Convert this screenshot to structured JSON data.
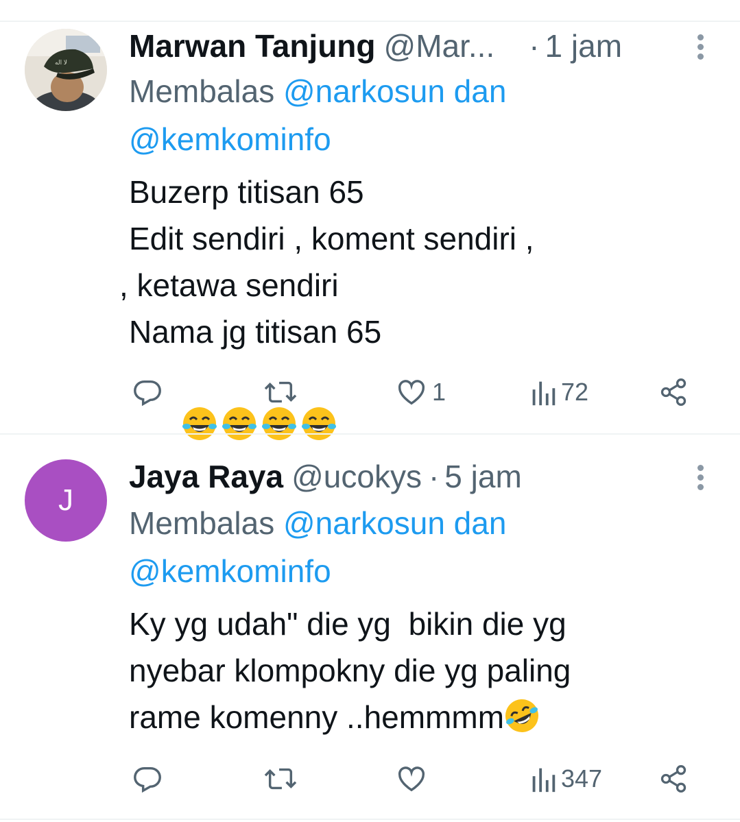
{
  "tweets": [
    {
      "name": "Marwan Tanjung",
      "handle": "@Mar...",
      "time": "1 jam",
      "reply_prefix": "Membalas ",
      "reply_to_1": "@narkosun",
      "reply_and": " dan",
      "reply_to_2": "@kemkominfo",
      "lines": [
        "Buzerp titisan 65",
        "Edit sendiri , koment sendiri ,",
        ", ketawa sendiri",
        "Nama jg titisan 65"
      ],
      "emoji": [
        "face-with-tears-of-joy",
        "face-with-tears-of-joy",
        "face-with-tears-of-joy",
        "face-with-tears-of-joy"
      ],
      "actions": {
        "reply": "",
        "retweet": "",
        "like": "1",
        "views": "72"
      },
      "avatar": "profile-photo"
    },
    {
      "name": "Jaya Raya",
      "handle": "@ucokys",
      "time": "5 jam",
      "reply_prefix": "Membalas ",
      "reply_to_1": "@narkosun",
      "reply_and": " dan",
      "reply_to_2": "@kemkominfo",
      "lines": [
        "Ky yg udah\" die yg  bikin die yg",
        "nyebar klompokny die yg paling",
        "rame komenny ..hemmmm"
      ],
      "emoji": [
        "rolling-on-the-floor-laughing"
      ],
      "actions": {
        "reply": "",
        "retweet": "",
        "like": "",
        "views": "347"
      },
      "avatar_letter": "J",
      "avatar_color": "#a94fc2"
    }
  ],
  "separator": "·",
  "colors": {
    "text": "#0f1419",
    "secondary": "#536471",
    "link": "#1d9bf0",
    "divider": "#eff3f4"
  }
}
